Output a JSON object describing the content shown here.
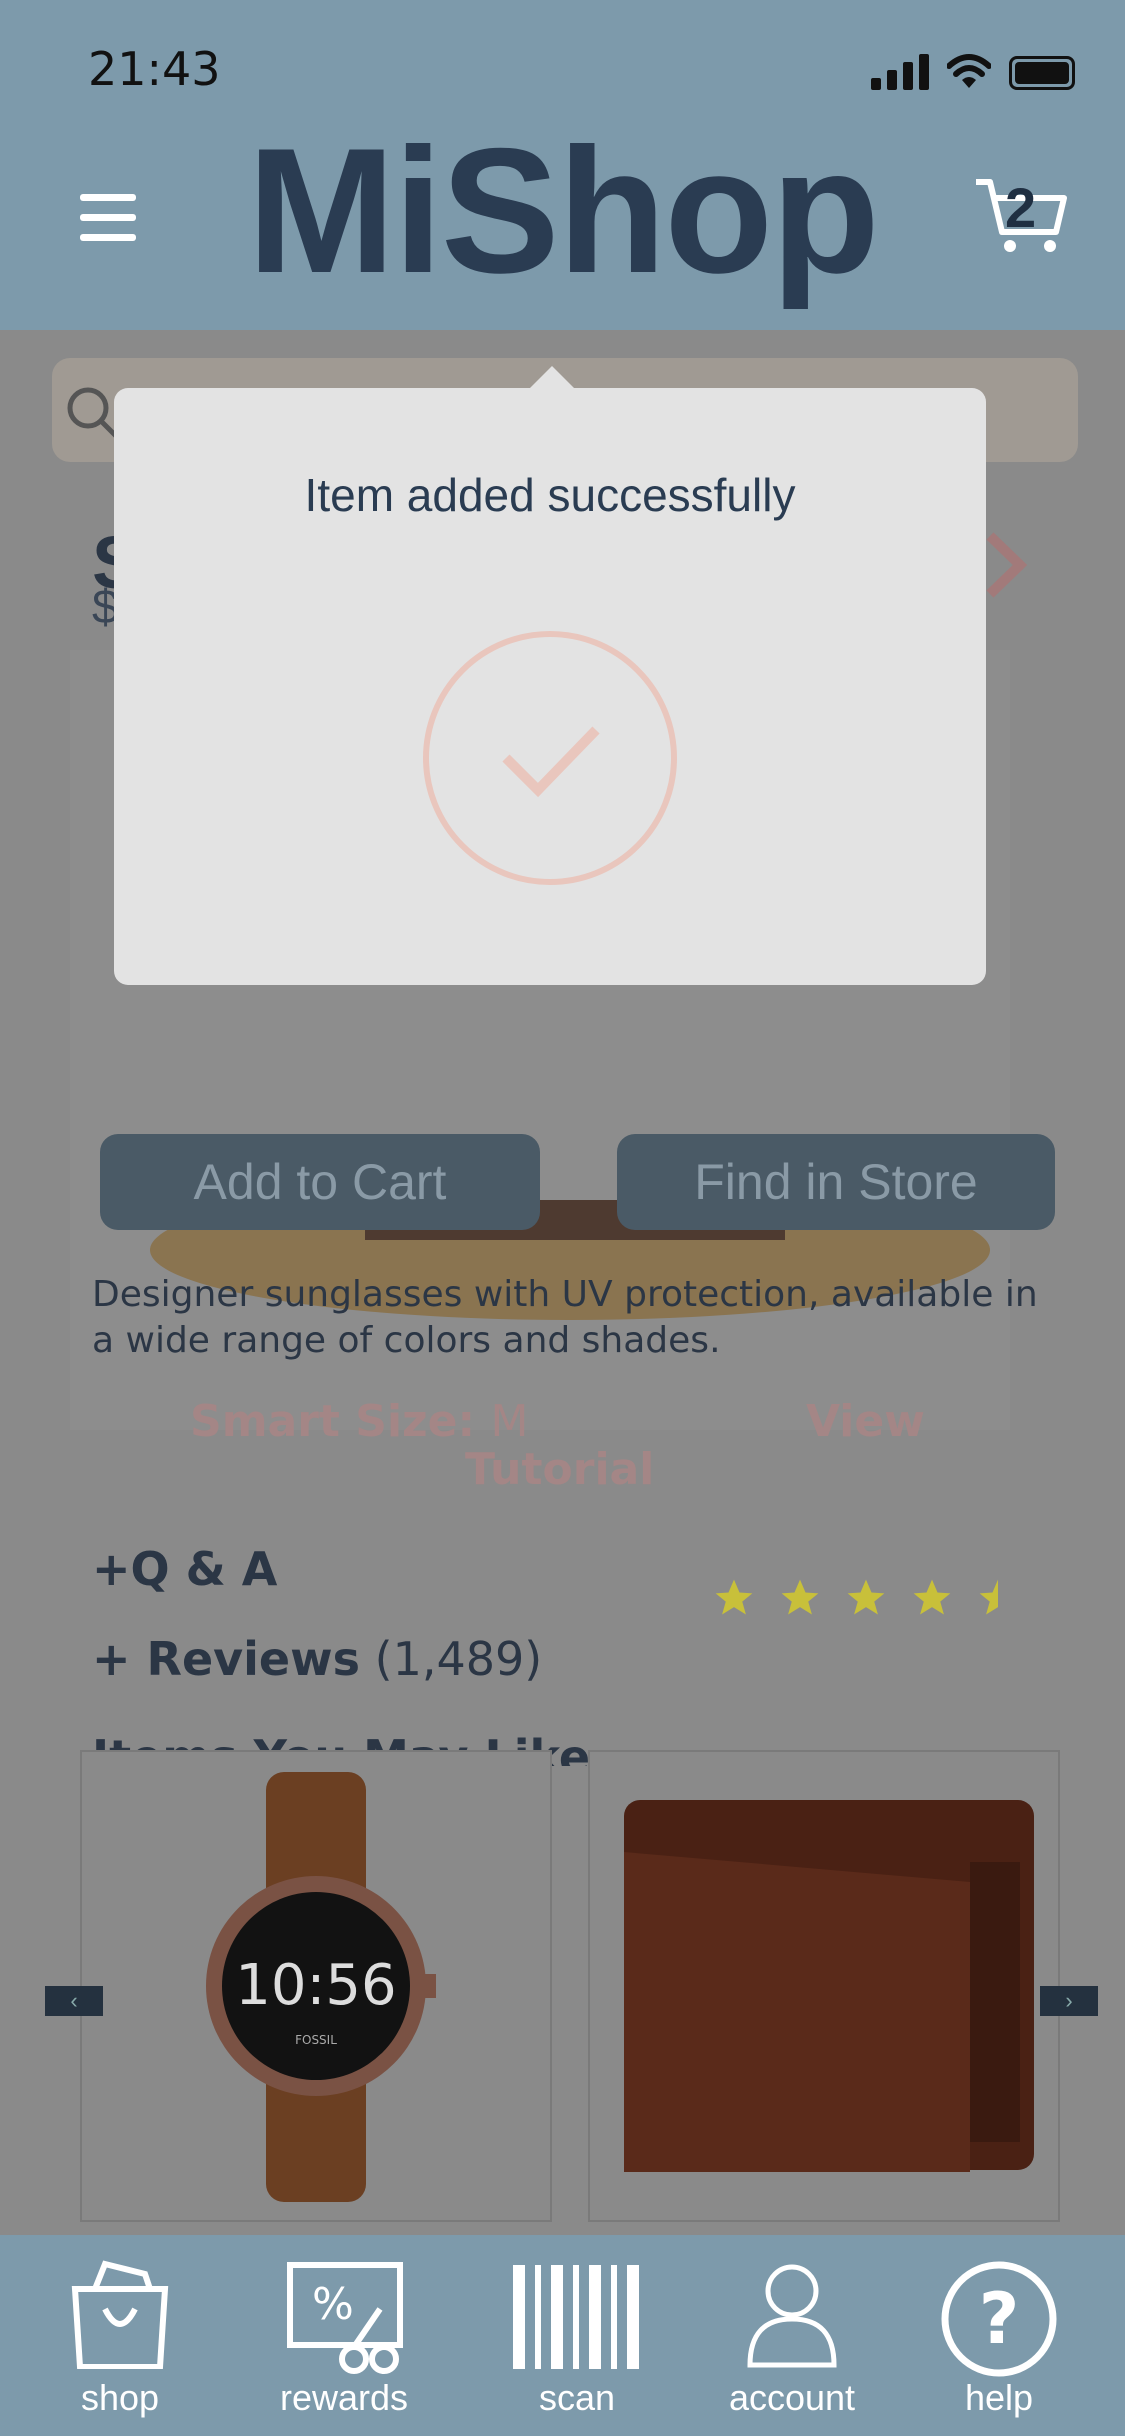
{
  "status": {
    "time": "21:43"
  },
  "header": {
    "logo": "MiShop",
    "cart_count": "2"
  },
  "product": {
    "title_partial": "S",
    "price_partial": "$",
    "add_to_cart": "Add to Cart",
    "find_in_store": "Find in Store",
    "description": "Designer sunglasses with UV protection, available in a wide range of colors and shades.",
    "smart_size_label": "Smart Size:",
    "smart_size_value": "M",
    "view_tutorial_1": "View",
    "view_tutorial_2": "Tutorial",
    "qa": "+Q & A",
    "reviews_label": "+ Reviews",
    "reviews_count": "(1,489)",
    "rating": 4.5,
    "items_you_may_like": "Items You May Like"
  },
  "popover": {
    "message": "Item added successfully"
  },
  "recommendations": [
    {
      "name": "smartwatch",
      "icon": "watch",
      "watch_time": "10:56",
      "watch_brand": "FOSSIL"
    },
    {
      "name": "wallet",
      "icon": "wallet"
    }
  ],
  "carousel": {
    "prev": "‹",
    "next": "›"
  },
  "tabs": [
    {
      "label": "shop",
      "icon": "shopping-bag"
    },
    {
      "label": "rewards",
      "icon": "coupon"
    },
    {
      "label": "scan",
      "icon": "barcode"
    },
    {
      "label": "account",
      "icon": "user"
    },
    {
      "label": "help",
      "icon": "question"
    }
  ],
  "colors": {
    "header_bg": "#7d9aab",
    "logo": "#2a3c52",
    "button": "#4a5a66",
    "popover": "#e3e3e3",
    "check": "#e9c6bd"
  }
}
